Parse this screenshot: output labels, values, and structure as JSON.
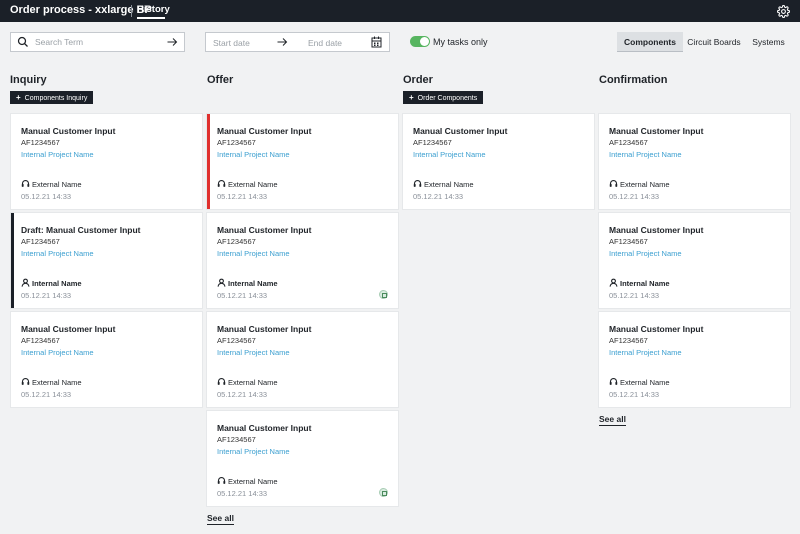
{
  "topbar": {
    "title": "Order process - xxlarge BP",
    "history": "History",
    "settings_icon": "gear-icon"
  },
  "filters": {
    "search_placeholder": "Search Term",
    "date_start": "Start date",
    "date_end": "End date",
    "my_tasks_label": "My tasks only",
    "my_tasks_on": true,
    "tabs": [
      "Components",
      "Circuit Boards",
      "Systems"
    ],
    "active_tab": "Components"
  },
  "columns": [
    {
      "title": "Inquiry",
      "button": "Components Inquiry",
      "cards": [
        {
          "title": "Manual Customer Input",
          "code": "AF1234567",
          "project": "Internal Project Name",
          "owner": "External Name",
          "date": "05.12.21 14:33"
        },
        {
          "title": "Draft: Manual Customer Input",
          "code": "AF1234567",
          "project": "Internal Project Name",
          "owner": "Internal Name",
          "date": "05.12.21 14:33"
        },
        {
          "title": "Manual Customer Input",
          "code": "AF1234567",
          "project": "Internal Project Name",
          "owner": "External Name",
          "date": "05.12.21 14:33"
        }
      ]
    },
    {
      "title": "Offer",
      "see_all": "See all",
      "cards": [
        {
          "title": "Manual Customer Input",
          "code": "AF1234567",
          "project": "Internal Project Name",
          "owner": "External Name",
          "date": "05.12.21 14:33"
        },
        {
          "title": "Manual Customer Input",
          "code": "AF1234567",
          "project": "Internal Project Name",
          "owner": "Internal Name",
          "date": "05.12.21 14:33"
        },
        {
          "title": "Manual Customer Input",
          "code": "AF1234567",
          "project": "Internal Project Name",
          "owner": "External Name",
          "date": "05.12.21 14:33"
        },
        {
          "title": "Manual Customer Input",
          "code": "AF1234567",
          "project": "Internal Project Name",
          "owner": "External Name",
          "date": "05.12.21 14:33"
        }
      ]
    },
    {
      "title": "Order",
      "button": "Order Components",
      "cards": [
        {
          "title": "Manual Customer Input",
          "code": "AF1234567",
          "project": "Internal Project Name",
          "owner": "External Name",
          "date": "05.12.21 14:33"
        }
      ]
    },
    {
      "title": "Confirmation",
      "see_all": "See all",
      "cards": [
        {
          "title": "Manual Customer Input",
          "code": "AF1234567",
          "project": "Internal Project Name",
          "owner": "External Name",
          "date": "05.12.21 14:33"
        },
        {
          "title": "Manual Customer Input",
          "code": "AF1234567",
          "project": "Internal Project Name",
          "owner": "Internal Name",
          "date": "05.12.21 14:33"
        },
        {
          "title": "Manual Customer Input",
          "code": "AF1234567",
          "project": "Internal Project Name",
          "owner": "External Name",
          "date": "05.12.21 14:33"
        }
      ]
    }
  ],
  "colors": {
    "accent_green": "#57b560",
    "link_blue": "#3b9fd0",
    "status_red": "#e0302e",
    "dark": "#1b2028"
  }
}
